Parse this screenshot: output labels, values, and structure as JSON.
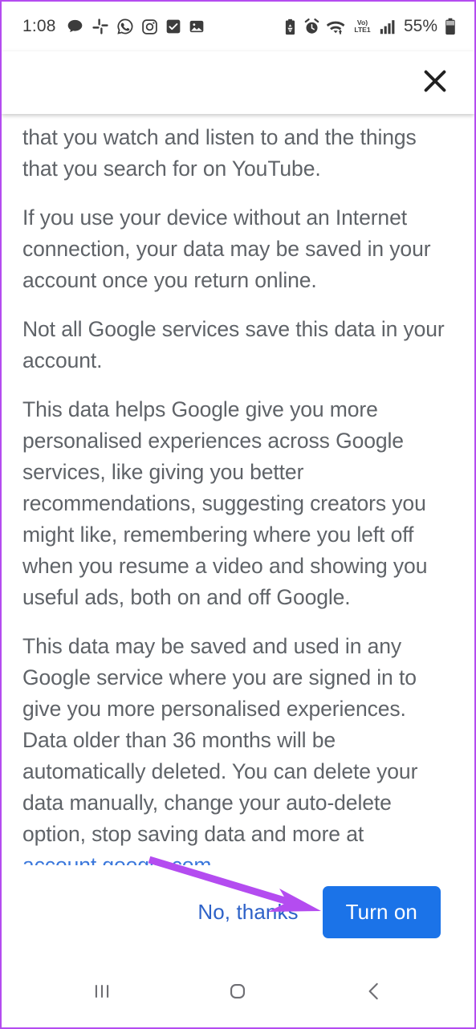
{
  "status_bar": {
    "time": "1:08",
    "battery_percent": "55%",
    "volte_label_top": "Vo)",
    "volte_label_bottom": "LTE1",
    "left_icons": [
      "message-bubble-icon",
      "slack-icon",
      "whatsapp-icon",
      "instagram-icon",
      "checkbox-checked-icon",
      "gallery-photo-icon"
    ],
    "right_icons": [
      "battery-saver-icon",
      "alarm-clock-icon",
      "wifi-transfer-icon",
      "volte-lte1-icon",
      "signal-bars-icon",
      "battery-icon"
    ]
  },
  "header": {
    "close_label": "close-icon"
  },
  "content": {
    "paragraphs": [
      "that you watch and listen to and the things that you search for on YouTube.",
      "If you use your device without an Internet connection, your data may be saved in your account once you return online.",
      "Not all Google services save this data in your account.",
      "This data helps Google give you more personalised experiences across Google services, like giving you better recommendations, suggesting creators you might like, remembering where you left off when you resume a video and showing you useful ads, both on and off Google."
    ],
    "final_paragraph_prefix": "This data may be saved and used in any Google service where you are signed in to give you more personalised experiences. Data older than 36 months will be automatically deleted. You can delete your data manually, change your auto-delete option, stop saving data and more at ",
    "final_paragraph_link": "account.google.com",
    "final_paragraph_suffix": "."
  },
  "actions": {
    "decline_label": "No, thanks",
    "confirm_label": "Turn on",
    "confirm_color": "#1b73e8",
    "decline_color": "#2e62c8"
  },
  "annotation": {
    "arrow_color": "#b44cf0",
    "points_to": "Turn on"
  },
  "nav_bar": {
    "recents_label": "recents-icon",
    "home_label": "home-icon",
    "back_label": "back-icon"
  },
  "colors": {
    "frame_border": "#b44cf0",
    "body_text": "#5f6368",
    "link": "#3b78dc"
  }
}
